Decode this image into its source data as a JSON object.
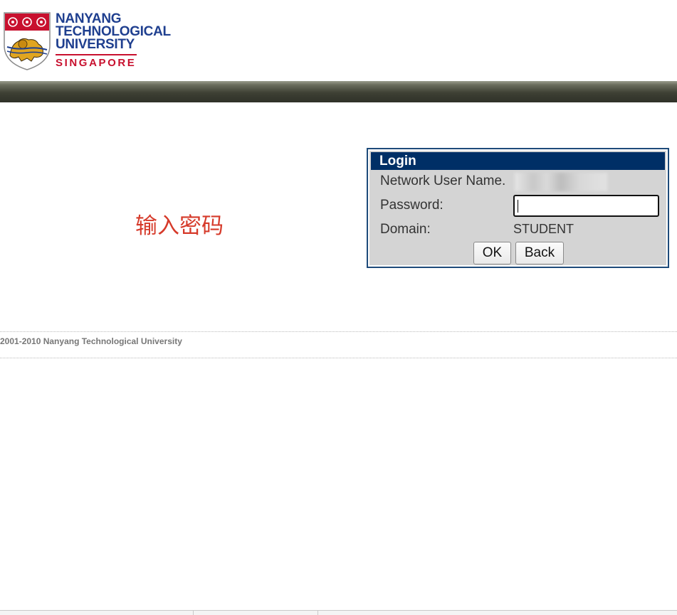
{
  "header": {
    "logo": {
      "line1": "NANYANG",
      "line2": "TECHNOLOGICAL",
      "line3": "UNIVERSITY",
      "line4": "SINGAPORE"
    }
  },
  "annotation": "输入密码",
  "login": {
    "title": "Login",
    "username_label": "Network User Name.",
    "password_label": "Password:",
    "password_value": "",
    "domain_label": "Domain:",
    "domain_value": "STUDENT",
    "ok_label": "OK",
    "back_label": "Back"
  },
  "footer": {
    "copyright": "2001-2010 Nanyang Technological University"
  },
  "colors": {
    "brand_blue": "#1f3f8f",
    "brand_red": "#c8102e",
    "login_title_bg": "#002f66",
    "annotation_red": "#d63a2a"
  }
}
